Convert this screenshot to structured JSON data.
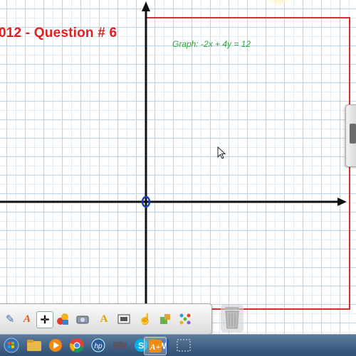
{
  "whiteboard": {
    "title": "012 - Question # 6",
    "graph_prompt": "Graph: -2x + 4y = 12"
  },
  "colors": {
    "title": "#e02020",
    "prompt": "#2fa43a",
    "frame": "#d23030",
    "grid_major": "#bcd3e6",
    "grid_minor": "#e3edf6",
    "axes": "#111111",
    "origin_marker": "#1a3fb0"
  },
  "toolbar": {
    "tools": [
      {
        "name": "pen-tool-icon",
        "glyph": "✎"
      },
      {
        "name": "text-tool-icon",
        "glyph": "A"
      },
      {
        "name": "move-tool-icon",
        "glyph": "✛"
      },
      {
        "name": "shapes-tool-icon",
        "glyph": "●"
      },
      {
        "name": "camera-tool-icon",
        "glyph": "▣"
      },
      {
        "name": "highlighter-tool-icon",
        "glyph": "A"
      },
      {
        "name": "image-tool-icon",
        "glyph": "▤"
      },
      {
        "name": "pointer-tool-icon",
        "glyph": "☝"
      },
      {
        "name": "insert-tool-icon",
        "glyph": "▦"
      },
      {
        "name": "scatter-tool-icon",
        "glyph": "✣"
      }
    ],
    "trash_icon": "trash-icon"
  },
  "taskbar": {
    "icons": [
      "windows-start-icon",
      "file-explorer-icon",
      "media-player-icon",
      "chrome-icon",
      "hp-icon",
      "camera-app-icon",
      "skype-icon",
      "word-icon",
      "text-app-icon",
      "snipping-tool-icon"
    ]
  }
}
